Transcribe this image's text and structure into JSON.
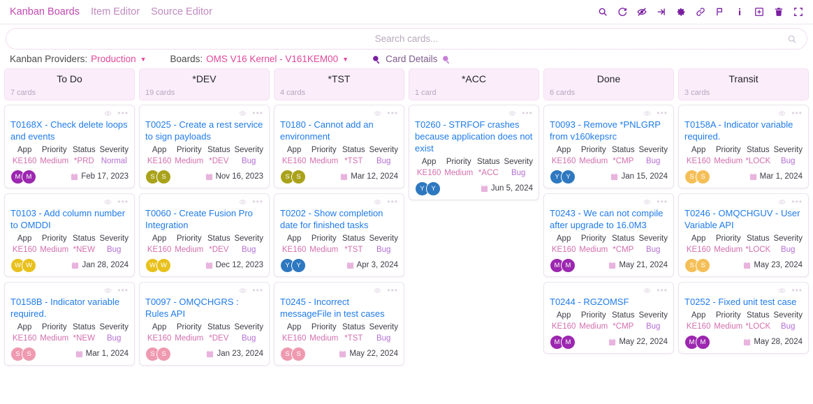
{
  "nav": {
    "links": [
      {
        "label": "Kanban Boards",
        "active": true
      },
      {
        "label": "Item Editor",
        "active": false
      },
      {
        "label": "Source Editor",
        "active": false
      }
    ],
    "tools": [
      {
        "name": "search-icon"
      },
      {
        "name": "refresh-icon"
      },
      {
        "name": "eye-off-icon"
      },
      {
        "name": "sign-in-icon"
      },
      {
        "name": "gear-icon"
      },
      {
        "name": "link-icon"
      },
      {
        "name": "flag-icon"
      },
      {
        "name": "info-icon"
      },
      {
        "name": "plus-box-icon"
      },
      {
        "name": "trash-icon"
      },
      {
        "name": "fullscreen-icon"
      }
    ]
  },
  "search": {
    "placeholder": "Search cards...",
    "value": ""
  },
  "providers": {
    "providers_label": "Kanban Providers:",
    "provider_value": "Production",
    "boards_label": "Boards:",
    "board_value": "OMS V16 Kernel - V161KEM00",
    "card_details_label": "Card Details"
  },
  "attr_headers": {
    "app": "App",
    "priority": "Priority",
    "status": "Status",
    "severity": "Severity"
  },
  "colors": {
    "accent_pink": "#e0489a",
    "nav_link": "#c147b0",
    "title_blue": "#1f7bea",
    "column_header_bg": "#fbeefa",
    "avatar_purple": "#9c27b0",
    "avatar_gold": "#e8c11c",
    "avatar_pink": "#ef9ab0",
    "avatar_olive": "#a9a21a",
    "avatar_blue": "#2e78c0",
    "avatar_orange": "#f5bf58"
  },
  "columns": [
    {
      "title": "To Do",
      "count": "7 cards",
      "cards": [
        {
          "title": "T0168X - Check delete loops and events",
          "app": "KE160",
          "priority": "Medium",
          "status": "*PRD",
          "severity": "Normal",
          "date": "Feb 17, 2023",
          "avatar_initial": "M",
          "avatar_color": "#9c27b0"
        },
        {
          "title": "T0103 - Add column number to OMDDI",
          "app": "KE160",
          "priority": "Medium",
          "status": "*NEW",
          "severity": "Bug",
          "date": "Jan 28, 2024",
          "avatar_initial": "W",
          "avatar_color": "#e8c11c"
        },
        {
          "title": "T0158B - Indicator variable required.",
          "app": "KE160",
          "priority": "Medium",
          "status": "*NEW",
          "severity": "Bug",
          "date": "Mar 1, 2024",
          "avatar_initial": "S",
          "avatar_color": "#ef9ab0"
        }
      ]
    },
    {
      "title": "*DEV",
      "count": "19 cards",
      "cards": [
        {
          "title": "T0025 - Create a rest service to sign payloads",
          "app": "KE160",
          "priority": "Medium",
          "status": "*DEV",
          "severity": "Bug",
          "date": "Nov 16, 2023",
          "avatar_initial": "S",
          "avatar_color": "#a9a21a"
        },
        {
          "title": "T0060 - Create Fusion Pro Integration",
          "app": "KE160",
          "priority": "Medium",
          "status": "*DEV",
          "severity": "Bug",
          "date": "Dec 12, 2023",
          "avatar_initial": "W",
          "avatar_color": "#e8c11c"
        },
        {
          "title": "T0097 - OMQCHGRS : Rules API",
          "app": "KE160",
          "priority": "Medium",
          "status": "*DEV",
          "severity": "Bug",
          "date": "Jan 23, 2024",
          "avatar_initial": "S",
          "avatar_color": "#ef9ab0"
        }
      ]
    },
    {
      "title": "*TST",
      "count": "4 cards",
      "cards": [
        {
          "title": "T0180 - Cannot add an environment",
          "app": "KE160",
          "priority": "Medium",
          "status": "*TST",
          "severity": "Bug",
          "date": "Mar 12, 2024",
          "avatar_initial": "S",
          "avatar_color": "#a9a21a"
        },
        {
          "title": "T0202 - Show completion date for finished tasks",
          "app": "KE160",
          "priority": "Medium",
          "status": "*TST",
          "severity": "Bug",
          "date": "Apr 3, 2024",
          "avatar_initial": "Y",
          "avatar_color": "#2e78c0"
        },
        {
          "title": "T0245 - Incorrect messageFile in test cases",
          "app": "KE160",
          "priority": "Medium",
          "status": "*TST",
          "severity": "Bug",
          "date": "May 22, 2024",
          "avatar_initial": "S",
          "avatar_color": "#ef9ab0"
        }
      ]
    },
    {
      "title": "*ACC",
      "count": "1 card",
      "cards": [
        {
          "title": "T0260 - STRFOF crashes because application does not exist",
          "app": "KE160",
          "priority": "Medium",
          "status": "*ACC",
          "severity": "Bug",
          "date": "Jun 5, 2024",
          "avatar_initial": "Y",
          "avatar_color": "#2e78c0"
        }
      ]
    },
    {
      "title": "Done",
      "count": "6 cards",
      "cards": [
        {
          "title": "T0093 - Remove *PNLGRP from v160kepsrc",
          "app": "KE160",
          "priority": "Medium",
          "status": "*CMP",
          "severity": "Bug",
          "date": "Jan 15, 2024",
          "avatar_initial": "Y",
          "avatar_color": "#2e78c0"
        },
        {
          "title": "T0243 - We can not compile after upgrade to 16.0M3",
          "app": "KE160",
          "priority": "Medium",
          "status": "*CMP",
          "severity": "Bug",
          "date": "May 21, 2024",
          "avatar_initial": "M",
          "avatar_color": "#9c27b0"
        },
        {
          "title": "T0244 - RGZOMSF",
          "app": "KE160",
          "priority": "Medium",
          "status": "*CMP",
          "severity": "Bug",
          "date": "May 22, 2024",
          "avatar_initial": "M",
          "avatar_color": "#9c27b0"
        }
      ]
    },
    {
      "title": "Transit",
      "count": "3 cards",
      "cards": [
        {
          "title": "T0158A - Indicator variable required.",
          "app": "KE160",
          "priority": "Medium",
          "status": "*LOCK",
          "severity": "Bug",
          "date": "Mar 1, 2024",
          "avatar_initial": "S",
          "avatar_color": "#f5bf58"
        },
        {
          "title": "T0246 - OMQCHGUV - User Variable API",
          "app": "KE160",
          "priority": "Medium",
          "status": "*LOCK",
          "severity": "Bug",
          "date": "May 23, 2024",
          "avatar_initial": "S",
          "avatar_color": "#f5bf58"
        },
        {
          "title": "T0252 - Fixed unit test case",
          "app": "KE160",
          "priority": "Medium",
          "status": "*LOCK",
          "severity": "Bug",
          "date": "May 28, 2024",
          "avatar_initial": "M",
          "avatar_color": "#9c27b0"
        }
      ]
    }
  ]
}
